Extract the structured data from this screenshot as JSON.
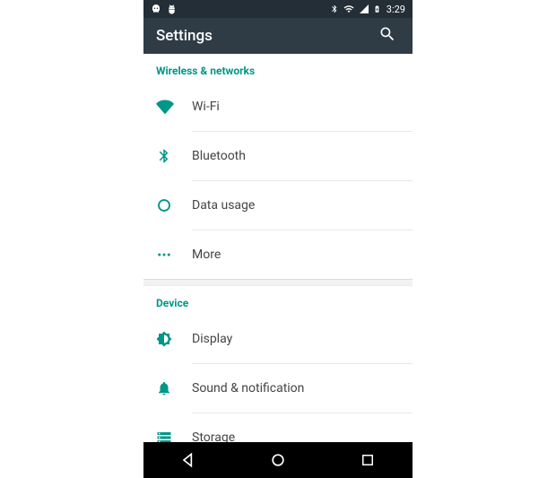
{
  "statusbar": {
    "time": "3:29"
  },
  "appbar": {
    "title": "Settings"
  },
  "sections": {
    "wireless": {
      "header": "Wireless & networks",
      "items": {
        "wifi": "Wi-Fi",
        "bluetooth": "Bluetooth",
        "data_usage": "Data usage",
        "more": "More"
      }
    },
    "device": {
      "header": "Device",
      "items": {
        "display": "Display",
        "sound": "Sound & notification",
        "storage": "Storage"
      }
    }
  }
}
